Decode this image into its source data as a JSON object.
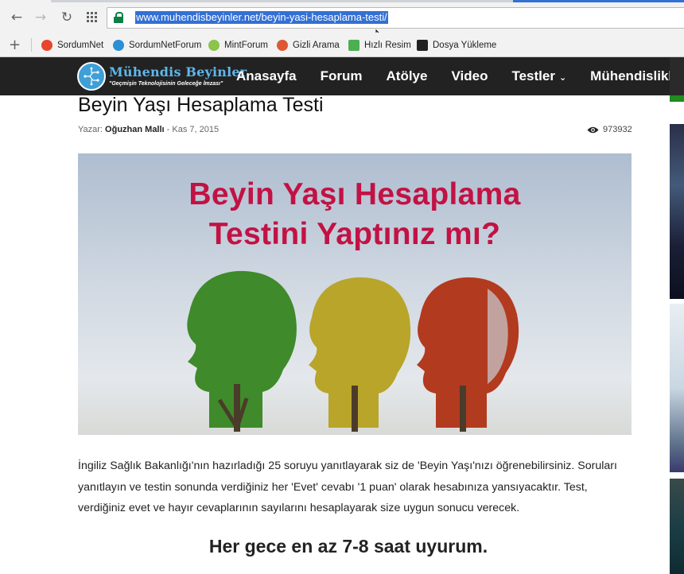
{
  "browser": {
    "url": "www.muhendisbeyinler.net/beyin-yasi-hesaplama-testi/",
    "bookmarks": [
      {
        "label": "SordumNet",
        "icon": "sordumnet-icon",
        "color": "#e8452c"
      },
      {
        "label": "SordumNetForum",
        "icon": "sordumnetforum-icon",
        "color": "#2b8fd6"
      },
      {
        "label": "MintForum",
        "icon": "mintforum-icon",
        "color": "#8cc34a"
      },
      {
        "label": "Gizli Arama",
        "icon": "duckduckgo-icon",
        "color": "#de5833"
      },
      {
        "label": "Hızlı Resim",
        "icon": "upload-image-icon",
        "color": "#4caf50"
      },
      {
        "label": "Dosya Yükleme",
        "icon": "cloud-upload-icon",
        "color": "#222222"
      }
    ]
  },
  "site": {
    "logo_title": "Mühendis Beyinler",
    "logo_slogan": "\"Geçmişin Teknolojisinin Geleceğe İmzası\"",
    "menu": [
      "Anasayfa",
      "Forum",
      "Atölye",
      "Video",
      "Testler",
      "Mühendislikler"
    ]
  },
  "article": {
    "title": "Beyin Yaşı Hesaplama Testi",
    "author_prefix": "Yazar:",
    "author": "Oğuzhan Mallı",
    "separator": "-",
    "date": "Kas 7, 2015",
    "views": "973932",
    "hero_line1": "Beyin Yaşı Hesaplama",
    "hero_line2": "Testini Yaptınız mı?",
    "intro": "İngiliz Sağlık Bakanlığı'nın hazırladığı 25 soruyu yanıtlayarak siz de 'Beyin Yaşı'nızı öğrenebilirsiniz. Soruları yanıtlayın ve testin sonunda verdiğiniz her 'Evet' cevabı '1 puan' olarak hesabınıza yansıyacaktır. Test, verdiğiniz evet ve hayır cevaplarının sayılarını hesaplayarak size uygun sonucu verecek.",
    "first_question": "Her gece en az 7-8 saat uyurum."
  },
  "colors": {
    "accent": "#3370d4",
    "header_bg": "#222222",
    "hero_text": "#c21244"
  }
}
